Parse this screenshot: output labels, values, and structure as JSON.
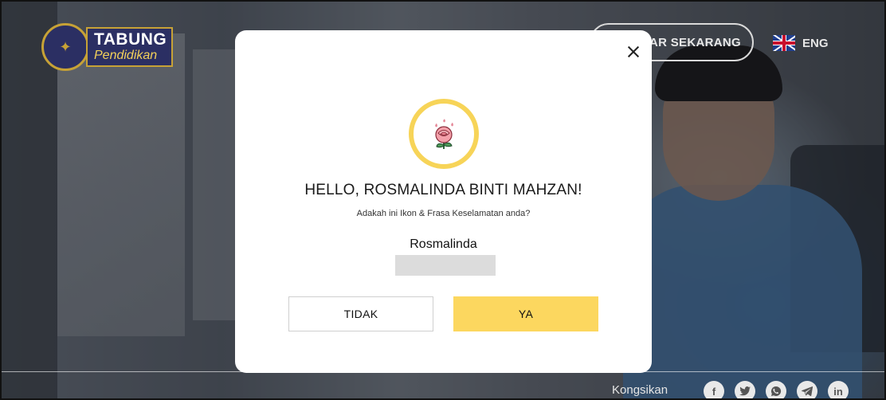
{
  "header": {
    "logo_line1": "TABUNG",
    "logo_line2": "Pendidikan",
    "register_label": "TFTAR SEKARANG",
    "language_label": "ENG"
  },
  "modal": {
    "greeting": "HELLO, ROSMALINDA BINTI MAHZAN!",
    "question": "Adakah ini Ikon & Frasa Keselamatan anda?",
    "security_phrase": "Rosmalinda",
    "security_icon": "rose-flower-icon",
    "no_label": "TIDAK",
    "yes_label": "YA"
  },
  "footer": {
    "share_label": "Kongsikan",
    "socials": [
      "facebook-icon",
      "twitter-icon",
      "whatsapp-icon",
      "telegram-icon",
      "linkedin-icon"
    ]
  },
  "colors": {
    "accent_yellow": "#fcd75f",
    "ring_yellow": "#f7d458",
    "brand_navy": "#2b2f63"
  }
}
